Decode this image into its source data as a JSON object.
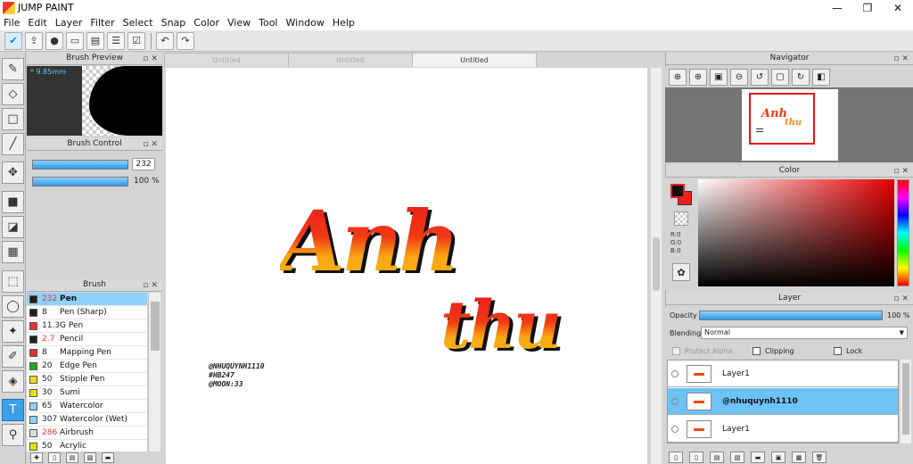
{
  "app": {
    "title": "JUMP PAINT"
  },
  "window": {
    "minimize": "—",
    "maximize": "❐",
    "close": "✕"
  },
  "menu": [
    "File",
    "Edit",
    "Layer",
    "Filter",
    "Select",
    "Snap",
    "Color",
    "View",
    "Tool",
    "Window",
    "Help"
  ],
  "toolbar": {
    "icons": [
      "check-icon",
      "share-icon",
      "comment-icon",
      "screen-icon",
      "document-icon",
      "list-icon",
      "checklist-icon"
    ],
    "undo": "↶",
    "redo": "↷"
  },
  "tools": [
    "pen-icon",
    "eraser-icon",
    "select-rect-icon",
    "line-icon",
    "move-icon",
    "fill-square-icon",
    "bucket-icon",
    "gradient-icon",
    "rect-select-icon",
    "lasso-icon",
    "wand-icon",
    "brush-select-icon",
    "eraser-select-icon",
    "text-icon",
    "eyedropper-icon"
  ],
  "brush_preview": {
    "title": "Brush Preview",
    "size": "* 9.85mm"
  },
  "brush_control": {
    "title": "Brush Control",
    "size_value": "232",
    "opacity_value": "100 %"
  },
  "brush": {
    "title": "Brush",
    "items": [
      {
        "num": "232",
        "name": "Pen",
        "color": "#1e1e1e",
        "numRed": true,
        "selected": true
      },
      {
        "num": "8",
        "name": "Pen (Sharp)",
        "color": "#1e1e1e",
        "numRed": false,
        "selected": false
      },
      {
        "num": "11.3",
        "name": "G Pen",
        "color": "#e23232",
        "numRed": false,
        "selected": false
      },
      {
        "num": "2.7",
        "name": "Pencil",
        "color": "#1e1e1e",
        "numRed": true,
        "selected": false
      },
      {
        "num": "8",
        "name": "Mapping Pen",
        "color": "#e23232",
        "numRed": false,
        "selected": false
      },
      {
        "num": "20",
        "name": "Edge Pen",
        "color": "#22aa22",
        "numRed": false,
        "selected": false
      },
      {
        "num": "50",
        "name": "Stipple Pen",
        "color": "#e8e010",
        "numRed": false,
        "selected": false
      },
      {
        "num": "30",
        "name": "Sumi",
        "color": "#e8e010",
        "numRed": false,
        "selected": false
      },
      {
        "num": "65",
        "name": "Watercolor",
        "color": "#8fd1fb",
        "numRed": false,
        "selected": false
      },
      {
        "num": "307",
        "name": "Watercolor (Wet)",
        "color": "#8fd1fb",
        "numRed": false,
        "selected": false
      },
      {
        "num": "286",
        "name": "Airbrush",
        "color": "#dddddd",
        "numRed": true,
        "selected": false
      },
      {
        "num": "50",
        "name": "Acrylic",
        "color": "#e8e010",
        "numRed": false,
        "selected": false
      }
    ]
  },
  "tabs": [
    "Untitled",
    "Untitled",
    "Untitled"
  ],
  "canvas": {
    "text_main": "Anh",
    "text_sub": "thu",
    "signature": [
      "@NHUQUYNH1110",
      "#HB247",
      "@MOON:33"
    ]
  },
  "navigator": {
    "title": "Navigator",
    "tools": [
      "zoom-fit-icon",
      "zoom-in-icon",
      "fit-icon",
      "zoom-out-icon",
      "rotate-left-icon",
      "fullscreen-icon",
      "rotate-right-icon",
      "flip-icon"
    ]
  },
  "color": {
    "title": "Color",
    "r": "R:0",
    "g": "G:0",
    "b": "B:0",
    "fg": "#111111",
    "bg": "#ef1d1d"
  },
  "layer": {
    "title": "Layer",
    "opacity_label": "Opacity",
    "opacity_value": "100 %",
    "blending_label": "Blending",
    "blending_value": "Normal",
    "protect_alpha": "Protect Alpha",
    "clipping": "Clipping",
    "lock": "Lock",
    "items": [
      {
        "name": "Layer1",
        "selected": false
      },
      {
        "name": "@nhuquynh1110",
        "selected": true
      },
      {
        "name": "Layer1",
        "selected": false
      }
    ]
  }
}
